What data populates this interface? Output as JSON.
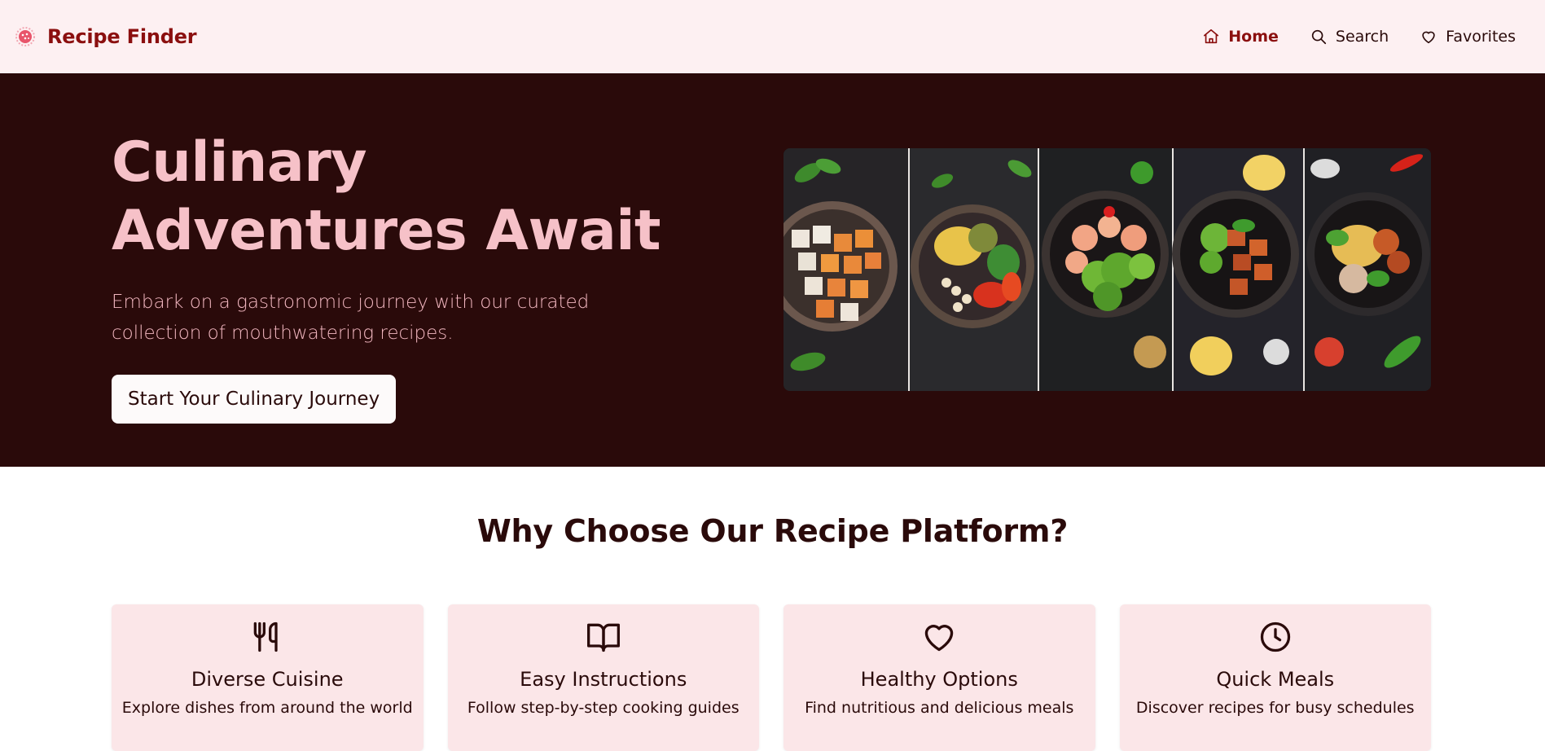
{
  "navbar": {
    "brand": {
      "title": "Recipe Finder",
      "logo_icon": "recipe-logo-icon"
    },
    "links": [
      {
        "label": "Home",
        "icon": "home-icon",
        "active": true
      },
      {
        "label": "Search",
        "icon": "search-icon",
        "active": false
      },
      {
        "label": "Favorites",
        "icon": "heart-icon",
        "active": false
      }
    ]
  },
  "hero": {
    "title": "Culinary Adventures Await",
    "subtitle": "Embark on a gastronomic journey with our curated collection of mouthwatering recipes.",
    "cta_label": "Start Your Culinary Journey",
    "image_alt": "Five bowls of colorful dishes on a dark background"
  },
  "features": {
    "title": "Why Choose Our Recipe Platform?",
    "cards": [
      {
        "icon": "utensils-icon",
        "title": "Diverse Cuisine",
        "description": "Explore dishes from around the world"
      },
      {
        "icon": "book-open-icon",
        "title": "Easy Instructions",
        "description": "Follow step-by-step cooking guides"
      },
      {
        "icon": "heart-icon",
        "title": "Healthy Options",
        "description": "Find nutritious and delicious meals"
      },
      {
        "icon": "clock-icon",
        "title": "Quick Meals",
        "description": "Discover recipes for busy schedules"
      }
    ]
  },
  "colors": {
    "navbar_bg": "#fdf0f2",
    "brand": "#8b0f0f",
    "hero_bg": "#2a0a0a",
    "hero_title": "#f6c1c8",
    "card_bg": "#fbe6e8"
  }
}
